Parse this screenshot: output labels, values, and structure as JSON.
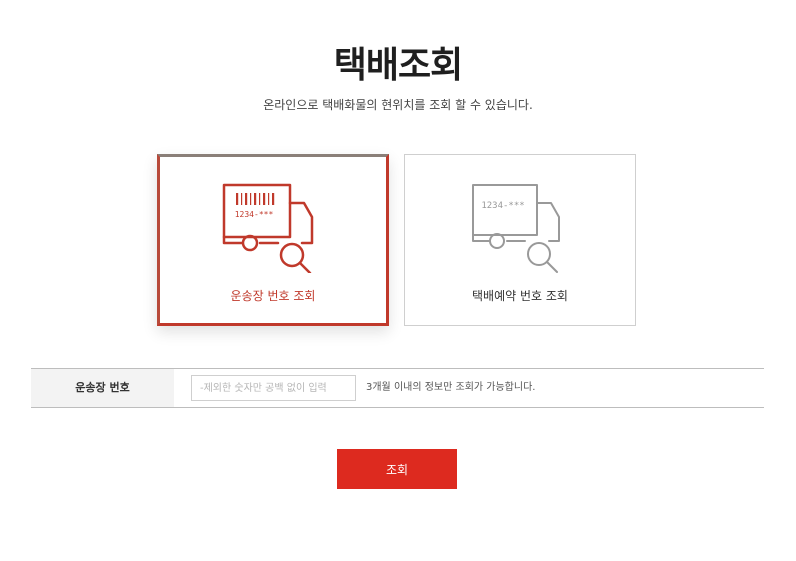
{
  "header": {
    "title": "택배조회",
    "subtitle": "온라인으로 택배화물의 현위치를 조회 할 수 있습니다."
  },
  "options": [
    {
      "label": "운송장 번호 조회",
      "code": "1234-***",
      "icon": "truck-barcode-search-icon",
      "selected": true
    },
    {
      "label": "택배예약 번호 조회",
      "code": "1234-***",
      "icon": "truck-number-search-icon",
      "selected": false
    }
  ],
  "form": {
    "label": "운송장 번호",
    "placeholder": "-제외한 숫자만 공백 없이 입력",
    "value": "",
    "note": "3개월 이내의 정보만 조회가 가능합니다."
  },
  "submit": {
    "label": "조회"
  },
  "colors": {
    "accent": "#dd2a1f",
    "active_icon": "#c0392b",
    "inactive_icon": "#999999"
  }
}
